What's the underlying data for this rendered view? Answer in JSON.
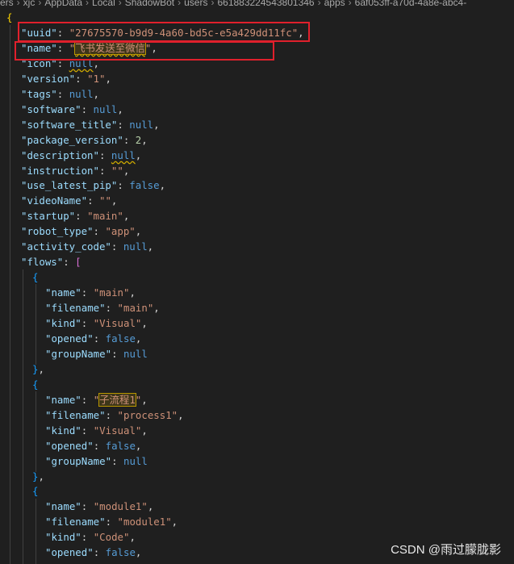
{
  "breadcrumb": [
    "ers",
    "xjc",
    "AppData",
    "Local",
    "ShadowBot",
    "users",
    "661883224543801346",
    "apps",
    "6af053ff-a70d-4a8e-abc4-"
  ],
  "file": {
    "uuid": "27675570-b9d9-4a60-bd5c-e5a429dd11fc",
    "name": "飞书发送至微信",
    "version": "1",
    "package_version": "2",
    "instruction": "",
    "use_latest_pip": "false",
    "videoName": "",
    "startup": "main",
    "robot_type": "app",
    "flows": [
      {
        "name": "main",
        "filename": "main",
        "kind": "Visual",
        "opened": "false",
        "groupName": "null"
      },
      {
        "name": "子流程1",
        "filename": "process1",
        "kind": "Visual",
        "opened": "false",
        "groupName": "null"
      },
      {
        "name": "module1",
        "filename": "module1",
        "kind": "Code",
        "opened": "false"
      }
    ]
  },
  "keys": {
    "uuid": "\"uuid\"",
    "name": "\"name\"",
    "icon": "\"icon\"",
    "version": "\"version\"",
    "tags": "\"tags\"",
    "software": "\"software\"",
    "software_title": "\"software_title\"",
    "package_version": "\"package_version\"",
    "description": "\"description\"",
    "instruction": "\"instruction\"",
    "use_latest_pip": "\"use_latest_pip\"",
    "videoName": "\"videoName\"",
    "startup": "\"startup\"",
    "robot_type": "\"robot_type\"",
    "activity_code": "\"activity_code\"",
    "flows": "\"flows\"",
    "filename": "\"filename\"",
    "kind": "\"kind\"",
    "opened": "\"opened\"",
    "groupName": "\"groupName\""
  },
  "literal_null": "null",
  "watermark": "CSDN @雨过朦胧影"
}
